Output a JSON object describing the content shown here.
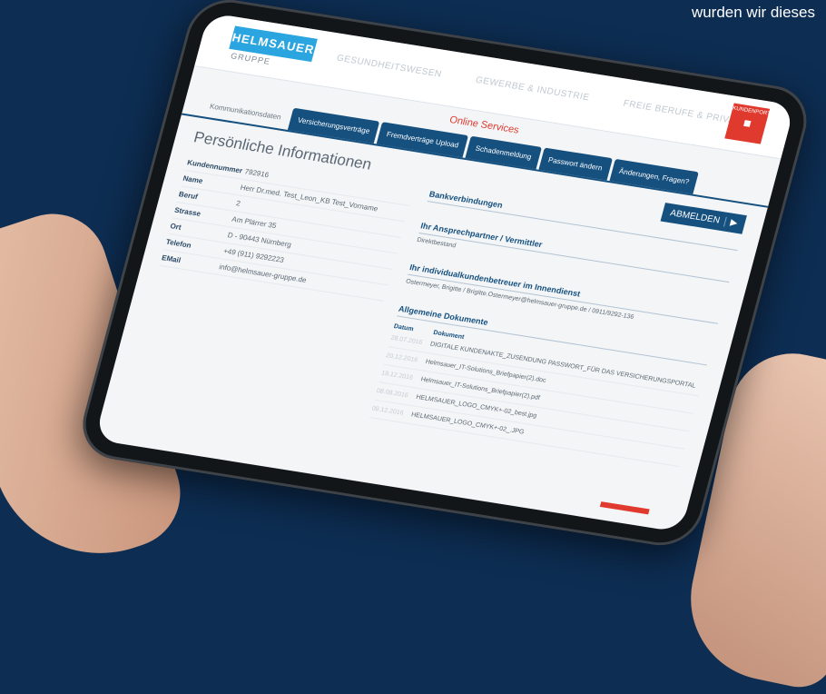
{
  "caption": "wurden wir dieses",
  "app": {
    "logo": "HELMSAUER",
    "logo_sub": "GRUPPE",
    "nav": [
      "GESUNDHEITSWESEN",
      "GEWERBE & INDUSTRIE",
      "FREIE BERUFE & PRIVATE"
    ],
    "portal_label": "KUNDENPORTAL",
    "subnav": "Online Services"
  },
  "tabs": [
    "Kommunikationsdaten",
    "Versicherungsverträge",
    "Fremdverträge Upload",
    "Schadenmeldung",
    "Passwort ändern",
    "Änderungen, Fragen?"
  ],
  "profile": {
    "title": "Persönliche Informationen",
    "rows": [
      {
        "label": "Kundennummer",
        "value": "792916"
      },
      {
        "label": "Name",
        "value": "Herr Dr.med. Test_Leon_KB Test_Vorname"
      },
      {
        "label": "Beruf",
        "value": "2"
      },
      {
        "label": "Strasse",
        "value": "Am Plärrer 35"
      },
      {
        "label": "Ort",
        "value": "D - 90443 Nürnberg"
      },
      {
        "label": "Telefon",
        "value": "+49 (911) 9292223"
      },
      {
        "label": "EMail",
        "value": "info@helmsauer-gruppe.de"
      }
    ]
  },
  "sidebar": {
    "logout": "ABMELDEN",
    "bank_title": "Bankverbindungen",
    "contact_title": "Ihr Ansprechpartner / Vermittler",
    "contact_value": "Direktbestand",
    "advisor_title": "Ihr individualkundenbetreuer im Innendienst",
    "advisor_value": "Ostermeyer, Brigitte / Brigitte.Ostermeyer@helmsauer-gruppe.de / 0911/9292-136"
  },
  "documents": {
    "title": "Allgemeine Dokumente",
    "col_date": "Datum",
    "col_doc": "Dokument",
    "rows": [
      {
        "date": "28.07.2016",
        "name": "DIGITALE KUNDENAKTE_ZUSENDUNG PASSWORT_FÜR DAS VERSICHERUNGSPORTAL"
      },
      {
        "date": "20.12.2016",
        "name": "Helmsauer_IT-Solutions_Briefpapier(2).doc"
      },
      {
        "date": "19.12.2016",
        "name": "Helmsauer_IT-Solutions_Briefpapier(2).pdf"
      },
      {
        "date": "08.08.2016",
        "name": "HELMSAUER_LOGO_CMYK+-02_best.jpg"
      },
      {
        "date": "09.12.2016",
        "name": "HELMSAUER_LOGO_CMYK+-02_.JPG"
      }
    ]
  }
}
